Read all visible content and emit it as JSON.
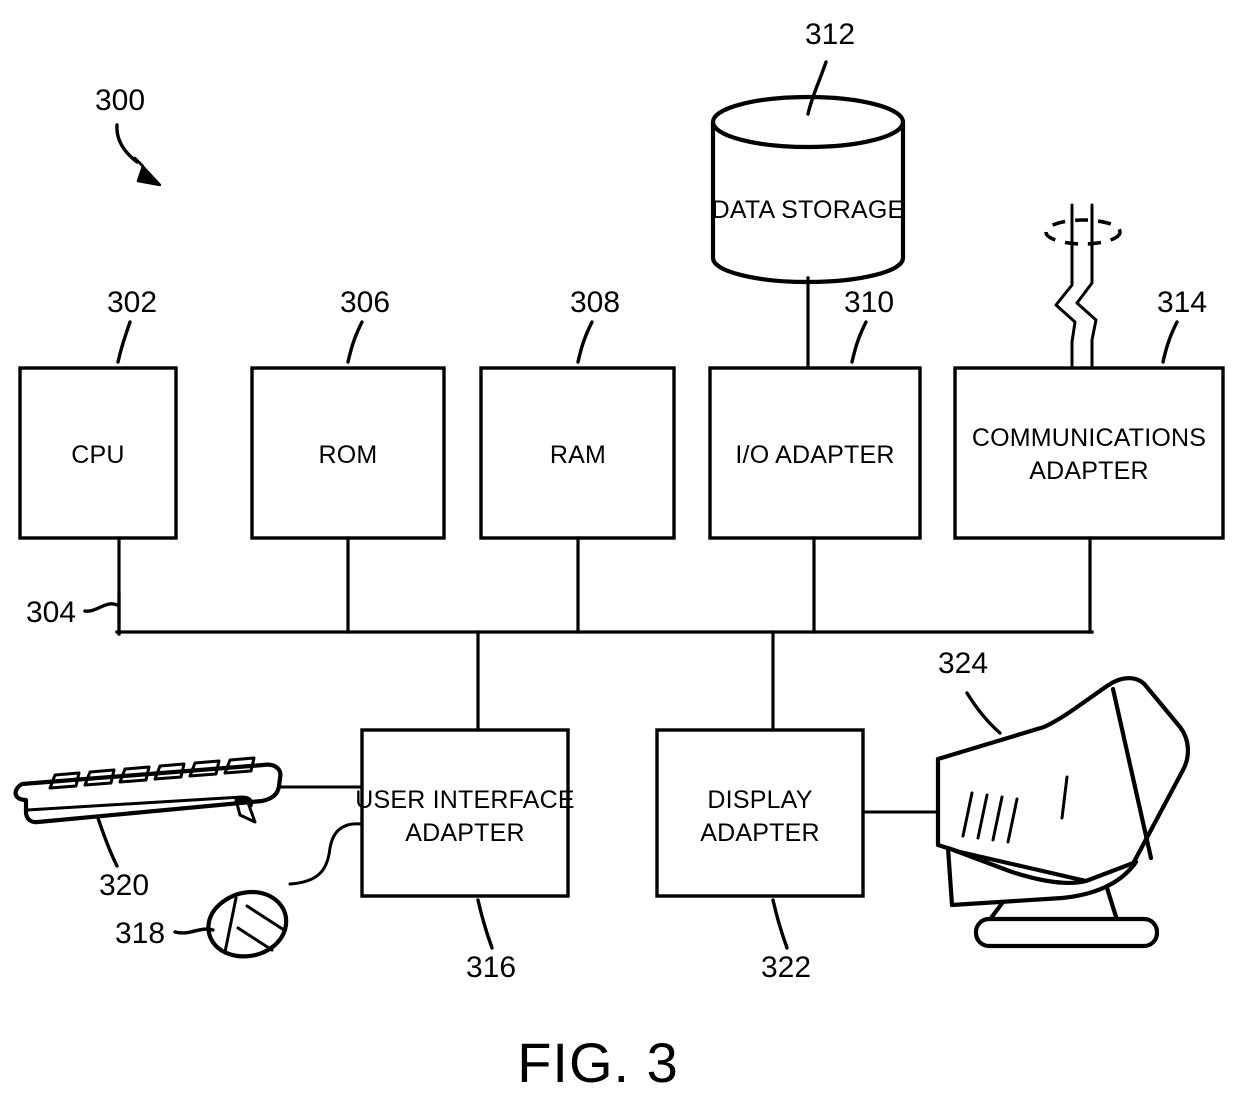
{
  "figure": {
    "caption": "FIG. 3",
    "system_ref": "300"
  },
  "blocks": [
    {
      "id": "cpu",
      "label_line1": "CPU",
      "label_line2": "",
      "ref": "302"
    },
    {
      "id": "rom",
      "label_line1": "ROM",
      "label_line2": "",
      "ref": "306"
    },
    {
      "id": "ram",
      "label_line1": "RAM",
      "label_line2": "",
      "ref": "308"
    },
    {
      "id": "ioad",
      "label_line1": "I/O ADAPTER",
      "label_line2": "",
      "ref": "310"
    },
    {
      "id": "commad",
      "label_line1": "COMMUNICATIONS",
      "label_line2": "ADAPTER",
      "ref": "314"
    },
    {
      "id": "uiad",
      "label_line1": "USER INTERFACE",
      "label_line2": "ADAPTER",
      "ref": "316"
    },
    {
      "id": "dispad",
      "label_line1": "DISPLAY",
      "label_line2": "ADAPTER",
      "ref": "322"
    }
  ],
  "storage": {
    "label": "DATA STORAGE",
    "ref": "312"
  },
  "bus": {
    "ref": "304"
  },
  "peripherals": [
    {
      "id": "keyboard",
      "name": "keyboard",
      "ref": "320"
    },
    {
      "id": "mouse",
      "name": "mouse",
      "ref": "318"
    },
    {
      "id": "monitor",
      "name": "display-monitor",
      "ref": "324"
    }
  ],
  "colors": {
    "ink": "#000000",
    "paper": "#ffffff"
  }
}
